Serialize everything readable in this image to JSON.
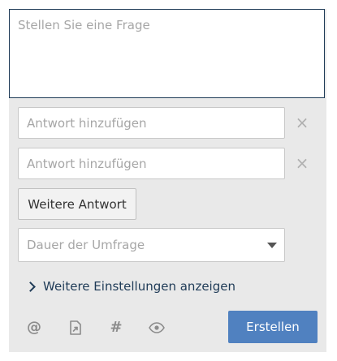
{
  "question": {
    "placeholder": "Stellen Sie eine Frage",
    "value": ""
  },
  "answers": [
    {
      "placeholder": "Antwort hinzufügen",
      "value": "",
      "remove_symbol": "×"
    },
    {
      "placeholder": "Antwort hinzufügen",
      "value": "",
      "remove_symbol": "×"
    }
  ],
  "more_answer_label": "Weitere Antwort",
  "duration": {
    "placeholder": "Dauer der Umfrage"
  },
  "settings_link_label": "Weitere Einstellungen anzeigen",
  "toolbar": {
    "mention_symbol": "@",
    "hashtag_symbol": "#",
    "icons": [
      "at-mention-icon",
      "attachment-icon",
      "hashtag-icon",
      "visibility-eye-icon"
    ]
  },
  "create_label": "Erstellen",
  "colors": {
    "accent": "#5081c0",
    "focus_border": "#1f3b57",
    "panel_background": "#e9e9e9",
    "link": "#1f3b57",
    "icon_gray": "#8c8c8c"
  }
}
